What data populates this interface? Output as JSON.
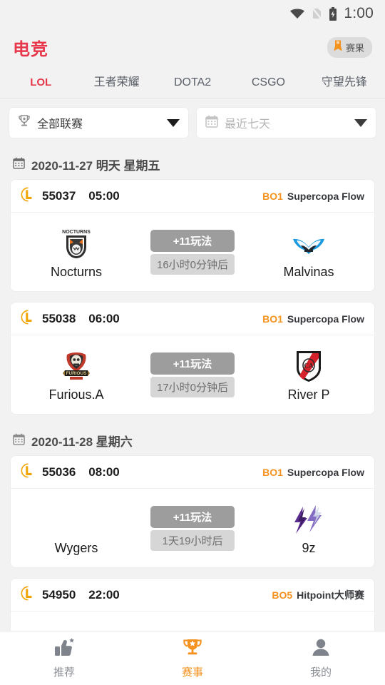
{
  "statusbar": {
    "time": "1:00",
    "wifi_icon": "wifi-icon",
    "sim_icon": "sim-off-icon",
    "battery_icon": "battery-charging-icon"
  },
  "header": {
    "brand": "电竞",
    "brand_color": "#e8364a",
    "result_button": {
      "label": "赛果",
      "icon": "medal-icon"
    }
  },
  "tabs": [
    {
      "label": "LOL",
      "active": true
    },
    {
      "label": "王者荣耀",
      "active": false
    },
    {
      "label": "DOTA2",
      "active": false
    },
    {
      "label": "CSGO",
      "active": false
    },
    {
      "label": "守望先锋",
      "active": false
    }
  ],
  "filters": [
    {
      "icon": "trophy-icon",
      "value": "全部联赛",
      "muted": false
    },
    {
      "icon": "calendar-icon",
      "value": "最近七天",
      "muted": true
    }
  ],
  "sections": [
    {
      "date_label": "2020-11-27 明天 星期五",
      "matches": [
        {
          "id": "55037",
          "time": "05:00",
          "bo": "BO1",
          "league": "Supercopa Flow",
          "home": {
            "name": "Nocturns",
            "logo": "nocturns-logo"
          },
          "away": {
            "name": "Malvinas",
            "logo": "malvinas-logo"
          },
          "play_badge": "+11玩法",
          "countdown": "16小时0分钟后"
        },
        {
          "id": "55038",
          "time": "06:00",
          "bo": "BO1",
          "league": "Supercopa Flow",
          "home": {
            "name": "Furious.A",
            "logo": "furious-logo"
          },
          "away": {
            "name": "River P",
            "logo": "riverp-logo"
          },
          "play_badge": "+11玩法",
          "countdown": "17小时0分钟后"
        }
      ]
    },
    {
      "date_label": "2020-11-28 星期六",
      "matches": [
        {
          "id": "55036",
          "time": "08:00",
          "bo": "BO1",
          "league": "Supercopa Flow",
          "home": {
            "name": "Wygers",
            "logo": "none"
          },
          "away": {
            "name": "9z",
            "logo": "ninez-logo"
          },
          "play_badge": "+11玩法",
          "countdown": "1天19小时后"
        }
      ]
    }
  ],
  "partial_match": {
    "id": "54950",
    "time": "22:00",
    "bo": "BO5",
    "league": "Hitpoint大师赛"
  },
  "bottom_nav": [
    {
      "label": "推荐",
      "icon": "thumbs-up-icon",
      "active": false
    },
    {
      "label": "赛事",
      "icon": "trophy-icon",
      "active": true
    },
    {
      "label": "我的",
      "icon": "person-icon",
      "active": false
    }
  ],
  "colors": {
    "accent_red": "#e8364a",
    "accent_orange": "#f5921e",
    "bg": "#f2f2f2"
  }
}
